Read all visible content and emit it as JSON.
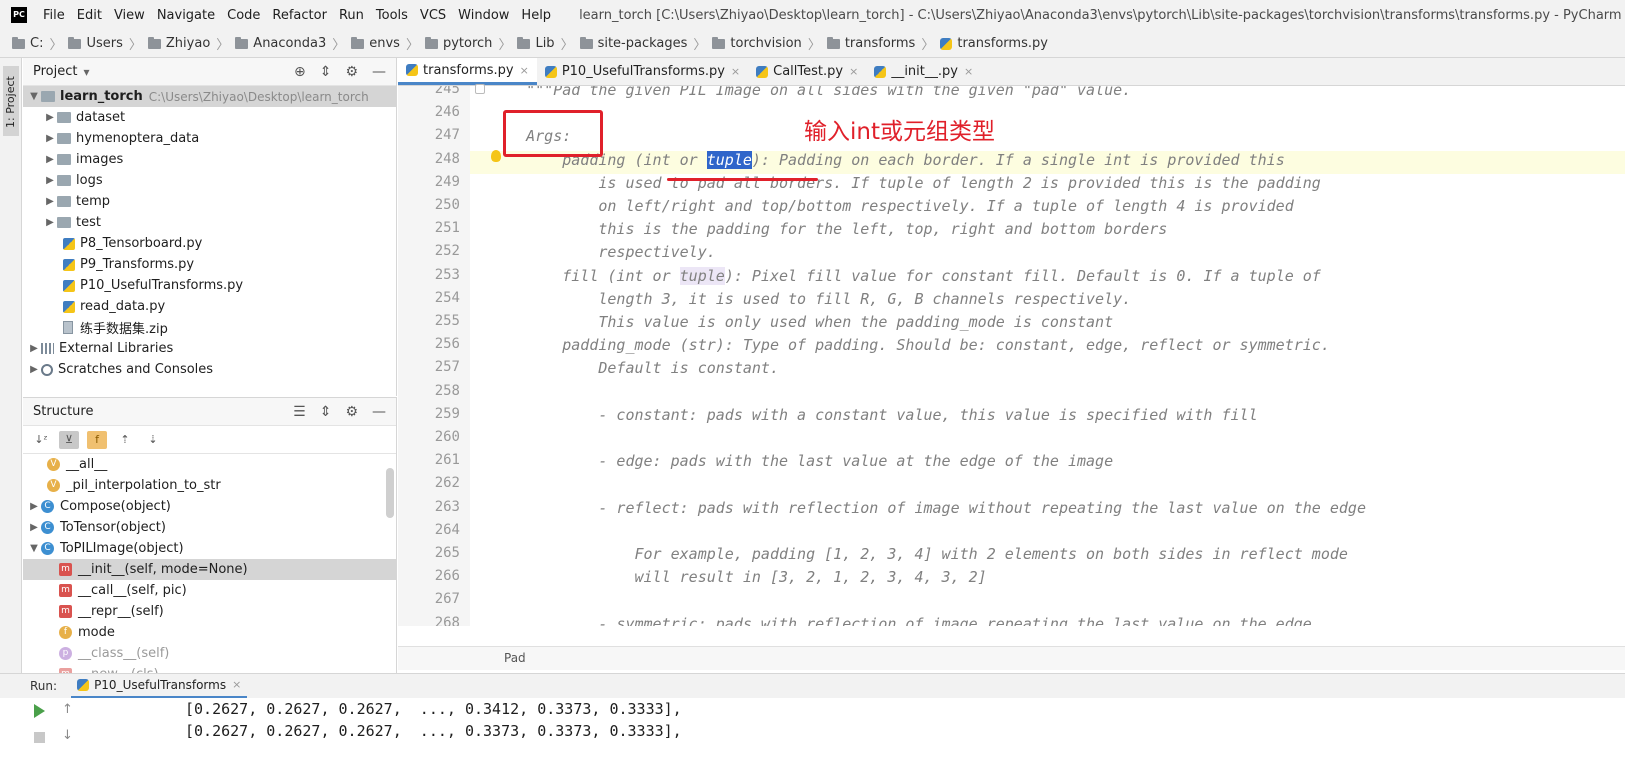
{
  "app": {
    "logo_text": "PC",
    "window_title": "learn_torch [C:\\Users\\Zhiyao\\Desktop\\learn_torch] - C:\\Users\\Zhiyao\\Anaconda3\\envs\\pytorch\\Lib\\site-packages\\torchvision\\transforms\\transforms.py - PyCharm"
  },
  "menu": [
    "File",
    "Edit",
    "View",
    "Navigate",
    "Code",
    "Refactor",
    "Run",
    "Tools",
    "VCS",
    "Window",
    "Help"
  ],
  "breadcrumb": [
    "C:",
    "Users",
    "Zhiyao",
    "Anaconda3",
    "envs",
    "pytorch",
    "Lib",
    "site-packages",
    "torchvision",
    "transforms",
    "transforms.py"
  ],
  "tool_strip": {
    "project_label": "1: Project"
  },
  "project_panel": {
    "title": "Project",
    "dropdown_glyph": "▾",
    "root": {
      "name": "learn_torch",
      "path": "C:\\Users\\Zhiyao\\Desktop\\learn_torch"
    },
    "folders": [
      "dataset",
      "hymenoptera_data",
      "images",
      "logs",
      "temp",
      "test"
    ],
    "files": [
      "P8_Tensorboard.py",
      "P9_Transforms.py",
      "P10_UsefulTransforms.py",
      "read_data.py",
      "练手数据集.zip"
    ],
    "external_libraries": "External Libraries",
    "scratches": "Scratches and Consoles"
  },
  "structure_panel": {
    "title": "Structure",
    "items": [
      {
        "icon": "v",
        "label": "__all__",
        "indent": 1
      },
      {
        "icon": "v",
        "label": "_pil_interpolation_to_str",
        "indent": 1
      },
      {
        "icon": "c",
        "label": "Compose(object)",
        "indent": 0
      },
      {
        "icon": "c",
        "label": "ToTensor(object)",
        "indent": 0
      },
      {
        "icon": "c",
        "label": "ToPILImage(object)",
        "indent": 0
      },
      {
        "icon": "m",
        "label": "__init__(self, mode=None)",
        "indent": 2
      },
      {
        "icon": "m",
        "label": "__call__(self, pic)",
        "indent": 2
      },
      {
        "icon": "m",
        "label": "__repr__(self)",
        "indent": 2
      },
      {
        "icon": "f",
        "label": "mode",
        "indent": 2
      },
      {
        "icon": "p",
        "label": "__class__(self)",
        "indent": 2
      },
      {
        "icon": "m",
        "label": "__new__(cls)",
        "indent": 2
      }
    ]
  },
  "editor": {
    "tabs": [
      {
        "label": "transforms.py",
        "active": true
      },
      {
        "label": "P10_UsefulTransforms.py",
        "active": false
      },
      {
        "label": "CallTest.py",
        "active": false
      },
      {
        "label": "__init__.py",
        "active": false
      }
    ],
    "close_glyph": "×",
    "lines": [
      {
        "n": "245",
        "text": "    \"\"\"Pad the given PIL Image on all sides with the given \"pad\" value."
      },
      {
        "n": "246",
        "text": ""
      },
      {
        "n": "247",
        "text": "    Args:"
      },
      {
        "n": "248",
        "text_pre": "        padding (int or ",
        "text_sel": "tuple",
        "text_post": "): Padding on each border. If a single int is provided this"
      },
      {
        "n": "249",
        "text": "            is used to pad all borders. If tuple of length 2 is provided this is the padding"
      },
      {
        "n": "250",
        "text": "            on left/right and top/bottom respectively. If a tuple of length 4 is provided"
      },
      {
        "n": "251",
        "text": "            this is the padding for the left, top, right and bottom borders"
      },
      {
        "n": "252",
        "text": "            respectively."
      },
      {
        "n": "253",
        "text_pre": "        fill (int or ",
        "text_hl": "tuple",
        "text_post": "): Pixel fill value for constant fill. Default is 0. If a tuple of"
      },
      {
        "n": "254",
        "text": "            length 3, it is used to fill R, G, B channels respectively."
      },
      {
        "n": "255",
        "text": "            This value is only used when the padding_mode is constant"
      },
      {
        "n": "256",
        "text": "        padding_mode (str): Type of padding. Should be: constant, edge, reflect or symmetric."
      },
      {
        "n": "257",
        "text": "            Default is constant."
      },
      {
        "n": "258",
        "text": ""
      },
      {
        "n": "259",
        "text": "            - constant: pads with a constant value, this value is specified with fill"
      },
      {
        "n": "260",
        "text": ""
      },
      {
        "n": "261",
        "text": "            - edge: pads with the last value at the edge of the image"
      },
      {
        "n": "262",
        "text": ""
      },
      {
        "n": "263",
        "text": "            - reflect: pads with reflection of image without repeating the last value on the edge"
      },
      {
        "n": "264",
        "text": ""
      },
      {
        "n": "265",
        "text": "                For example, padding [1, 2, 3, 4] with 2 elements on both sides in reflect mode"
      },
      {
        "n": "266",
        "text": "                will result in [3, 2, 1, 2, 3, 4, 3, 2]"
      },
      {
        "n": "267",
        "text": ""
      },
      {
        "n": "268",
        "text": "            - symmetric: pads with reflection of image repeating the last value on the edge"
      }
    ],
    "footer_breadcrumb": "Pad",
    "annotation_text": "输入int或元组类型"
  },
  "run_panel": {
    "label": "Run:",
    "tab": "P10_UsefulTransforms",
    "output": [
      "[0.2627, 0.2627, 0.2627,  ..., 0.3412, 0.3373, 0.3333],",
      "[0.2627, 0.2627, 0.2627,  ..., 0.3373, 0.3373, 0.3333],"
    ]
  },
  "colors": {
    "annotation": "#e0202a",
    "selection": "#2f65ca",
    "tab_underline": "#4a86c8",
    "docstring": "#808080"
  }
}
